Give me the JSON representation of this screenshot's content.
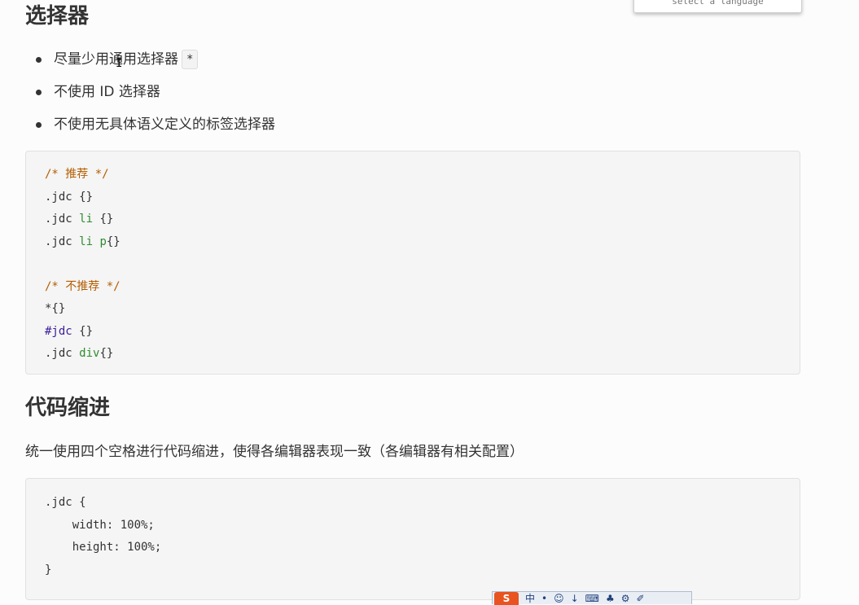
{
  "language_popup": {
    "label": "select a language"
  },
  "section1": {
    "title": "选择器",
    "bullets": [
      {
        "text": "尽量少用通用选择器",
        "code": "*"
      },
      {
        "text": "不使用 ID 选择器"
      },
      {
        "text": "不使用无具体语义定义的标签选择器"
      }
    ]
  },
  "code1": {
    "lines": [
      {
        "kind": "comment",
        "text": "/* 推荐 */"
      },
      {
        "kind": "plain",
        "sel": ".jdc",
        "tag": "",
        "rest": " {}"
      },
      {
        "kind": "plain",
        "sel": ".jdc ",
        "tag": "li",
        "rest": " {}"
      },
      {
        "kind": "plain",
        "sel": ".jdc ",
        "tag": "li p",
        "rest": "{}"
      },
      {
        "kind": "blank",
        "text": ""
      },
      {
        "kind": "comment",
        "text": "/* 不推荐 */"
      },
      {
        "kind": "text",
        "text": "*{}"
      },
      {
        "kind": "id",
        "id": "#jdc",
        "rest": " {}"
      },
      {
        "kind": "plain",
        "sel": ".jdc ",
        "tag": "div",
        "rest": "{}"
      }
    ]
  },
  "section2": {
    "title": "代码缩进",
    "description": "统一使用四个空格进行代码缩进，使得各编辑器表现一致（各编辑器有相关配置）"
  },
  "code2": {
    "lines": [
      ".jdc {",
      "    width: 100%;",
      "    height: 100%;",
      "}"
    ]
  },
  "taskbar": {
    "logo": "S",
    "icons": [
      "中",
      "•",
      "☺",
      "↓",
      "⌨",
      "♣",
      "⚙",
      "✐"
    ]
  }
}
